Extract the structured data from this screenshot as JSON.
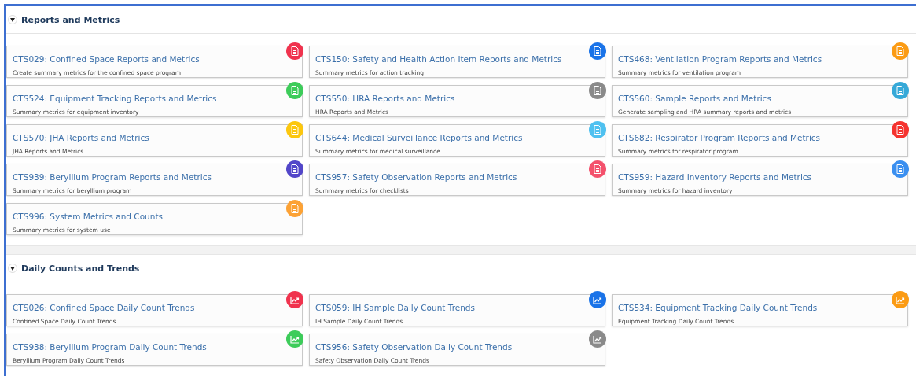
{
  "sections": [
    {
      "title": "Reports and Metrics",
      "expanded": true,
      "tiles": [
        {
          "title": "CTS029: Confined Space Reports and Metrics",
          "description": "Create summary metrics for the confined space program",
          "kind": "report",
          "color": "#f0334e"
        },
        {
          "title": "CTS150: Safety and Health Action Item Reports and Metrics",
          "description": "Summary metrics for action tracking",
          "kind": "report",
          "color": "#1a73e8"
        },
        {
          "title": "CTS468: Ventilation Program Reports and Metrics",
          "description": "Summary metrics for ventilation program",
          "kind": "report",
          "color": "#fb9b14"
        },
        {
          "title": "CTS524: Equipment Tracking Reports and Metrics",
          "description": "Summary metrics for equipment inventory",
          "kind": "report",
          "color": "#3dcc5a"
        },
        {
          "title": "CTS550: HRA Reports and Metrics",
          "description": "HRA Reports and Metrics",
          "kind": "report",
          "color": "#8a8a8a"
        },
        {
          "title": "CTS560: Sample Reports and Metrics",
          "description": "Generate sampling and HRA summary reports and metrics",
          "kind": "report",
          "color": "#36a9d8"
        },
        {
          "title": "CTS570: JHA Reports and Metrics",
          "description": "JHA Reports and Metrics",
          "kind": "report",
          "color": "#fcc70f"
        },
        {
          "title": "CTS644: Medical Surveillance Reports and Metrics",
          "description": "Summary metrics for medical surveillance",
          "kind": "report",
          "color": "#4fc1f0"
        },
        {
          "title": "CTS682: Respirator Program Reports and Metrics",
          "description": "Summary metrics for respirator program",
          "kind": "report",
          "color": "#f5332f"
        },
        {
          "title": "CTS939: Beryllium Program Reports and Metrics",
          "description": "Summary metrics for beryllium program",
          "kind": "report",
          "color": "#5246c9"
        },
        {
          "title": "CTS957: Safety Observation Reports and Metrics",
          "description": "Summary metrics for checklists",
          "kind": "report",
          "color": "#f4516c"
        },
        {
          "title": "CTS959: Hazard Inventory Reports and Metrics",
          "description": "Summary metrics for hazard inventory",
          "kind": "report",
          "color": "#3a8ff0"
        },
        {
          "title": "CTS996: System Metrics and Counts",
          "description": "Summary metrics for system use",
          "kind": "report",
          "color": "#fca235"
        }
      ]
    },
    {
      "title": "Daily Counts and Trends",
      "expanded": true,
      "tiles": [
        {
          "title": "CTS026: Confined Space Daily Count Trends",
          "description": "Confined Space Daily Count Trends",
          "kind": "trend",
          "color": "#f0334e"
        },
        {
          "title": "CTS059: IH Sample Daily Count Trends",
          "description": "IH Sample Daily Count Trends",
          "kind": "trend",
          "color": "#1a73e8"
        },
        {
          "title": "CTS534: Equipment Tracking Daily Count Trends",
          "description": "Equipment Tracking Daily Count Trends",
          "kind": "trend",
          "color": "#fb9b14"
        },
        {
          "title": "CTS938: Beryllium Program Daily Count Trends",
          "description": "Beryllium Program Daily Count Trends",
          "kind": "trend",
          "color": "#3dcc5a"
        },
        {
          "title": "CTS956: Safety Observation Daily Count Trends",
          "description": "Safety Observation Daily Count Trends",
          "kind": "trend",
          "color": "#8a8a8a"
        }
      ]
    }
  ]
}
